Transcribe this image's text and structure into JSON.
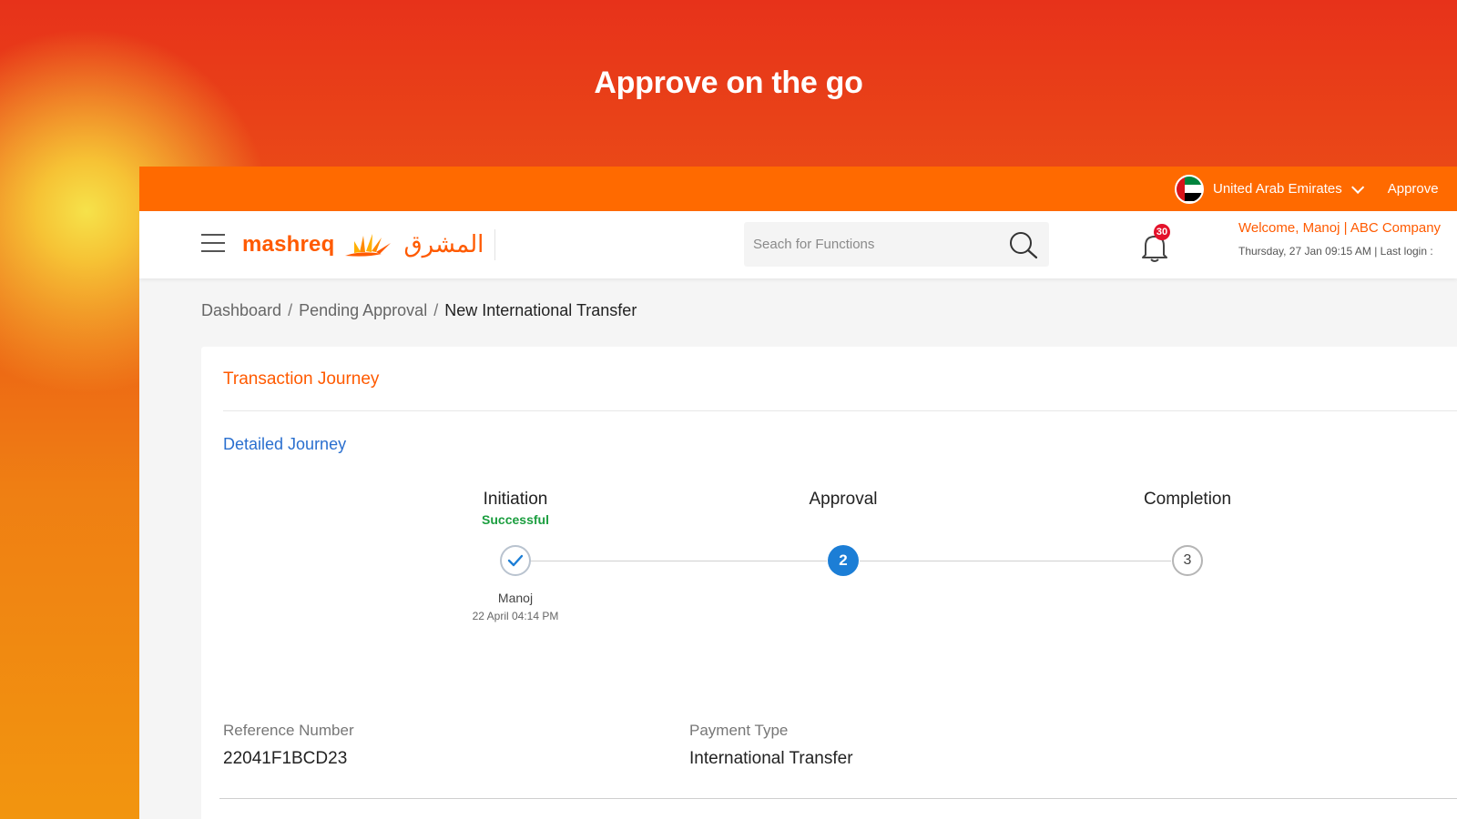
{
  "hero": {
    "title": "Approve on the go"
  },
  "topbar": {
    "country": "United Arab Emirates",
    "approve_link": "Approve"
  },
  "header": {
    "logo_en": "mashreq",
    "logo_ar": "المشرق",
    "search_placeholder": "Seach for Functions",
    "notification_count": "30",
    "welcome": "Welcome, Manoj | ABC Company",
    "last_login": "Thursday, 27 Jan 09:15 AM | Last login :"
  },
  "breadcrumb": {
    "items": [
      "Dashboard",
      "Pending Approval"
    ],
    "current": "New International Transfer"
  },
  "card": {
    "title": "Transaction Journey",
    "link": "Detailed Journey",
    "steps": [
      {
        "label": "Initiation",
        "status": "Successful",
        "person": "Manoj",
        "time": "22 April 04:14 PM",
        "state": "done"
      },
      {
        "label": "Approval",
        "number": "2",
        "state": "active"
      },
      {
        "label": "Completion",
        "number": "3",
        "state": "pending"
      }
    ],
    "fields": [
      {
        "label": "Reference Number",
        "value": "22041F1BCD23"
      },
      {
        "label": "Payment Type",
        "value": "International Transfer"
      }
    ]
  },
  "colors": {
    "brand_orange": "#ff6a00",
    "link_blue": "#2a6fcf",
    "success_green": "#1b9e3f",
    "active_step_blue": "#1c7ed6",
    "badge_red": "#e4122b"
  }
}
